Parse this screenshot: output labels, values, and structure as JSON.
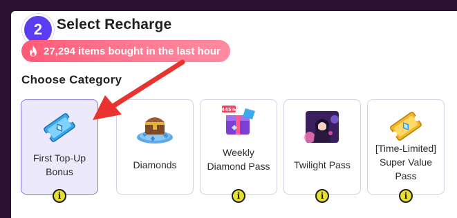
{
  "header": {
    "step_number": "2",
    "title": "Select Recharge"
  },
  "social_proof": {
    "text": "27,294 items bought in the last hour",
    "icon": "flame-icon",
    "color": "#ff6b85"
  },
  "category": {
    "label": "Choose Category",
    "selected_index": 0,
    "items": [
      {
        "label": "First Top-Up Bonus",
        "icon": "blue-ticket-icon",
        "info": "i"
      },
      {
        "label": "Diamonds",
        "icon": "diamond-chest-icon",
        "info": "i"
      },
      {
        "label": "Weekly Diamond Pass",
        "icon": "weekly-pass-box-icon",
        "info": "i"
      },
      {
        "label": "Twilight Pass",
        "icon": "hero-portrait-icon",
        "info": "i"
      },
      {
        "label": "[Time-Limited] Super Value Pass",
        "icon": "gold-ticket-icon",
        "info": "i"
      }
    ]
  },
  "annotation": {
    "arrow_color": "#e8332f"
  },
  "colors": {
    "accent": "#5b3cf0",
    "selected_border": "#8575e0",
    "selected_bg": "#ece9fb",
    "info_badge": "#e8df32"
  }
}
